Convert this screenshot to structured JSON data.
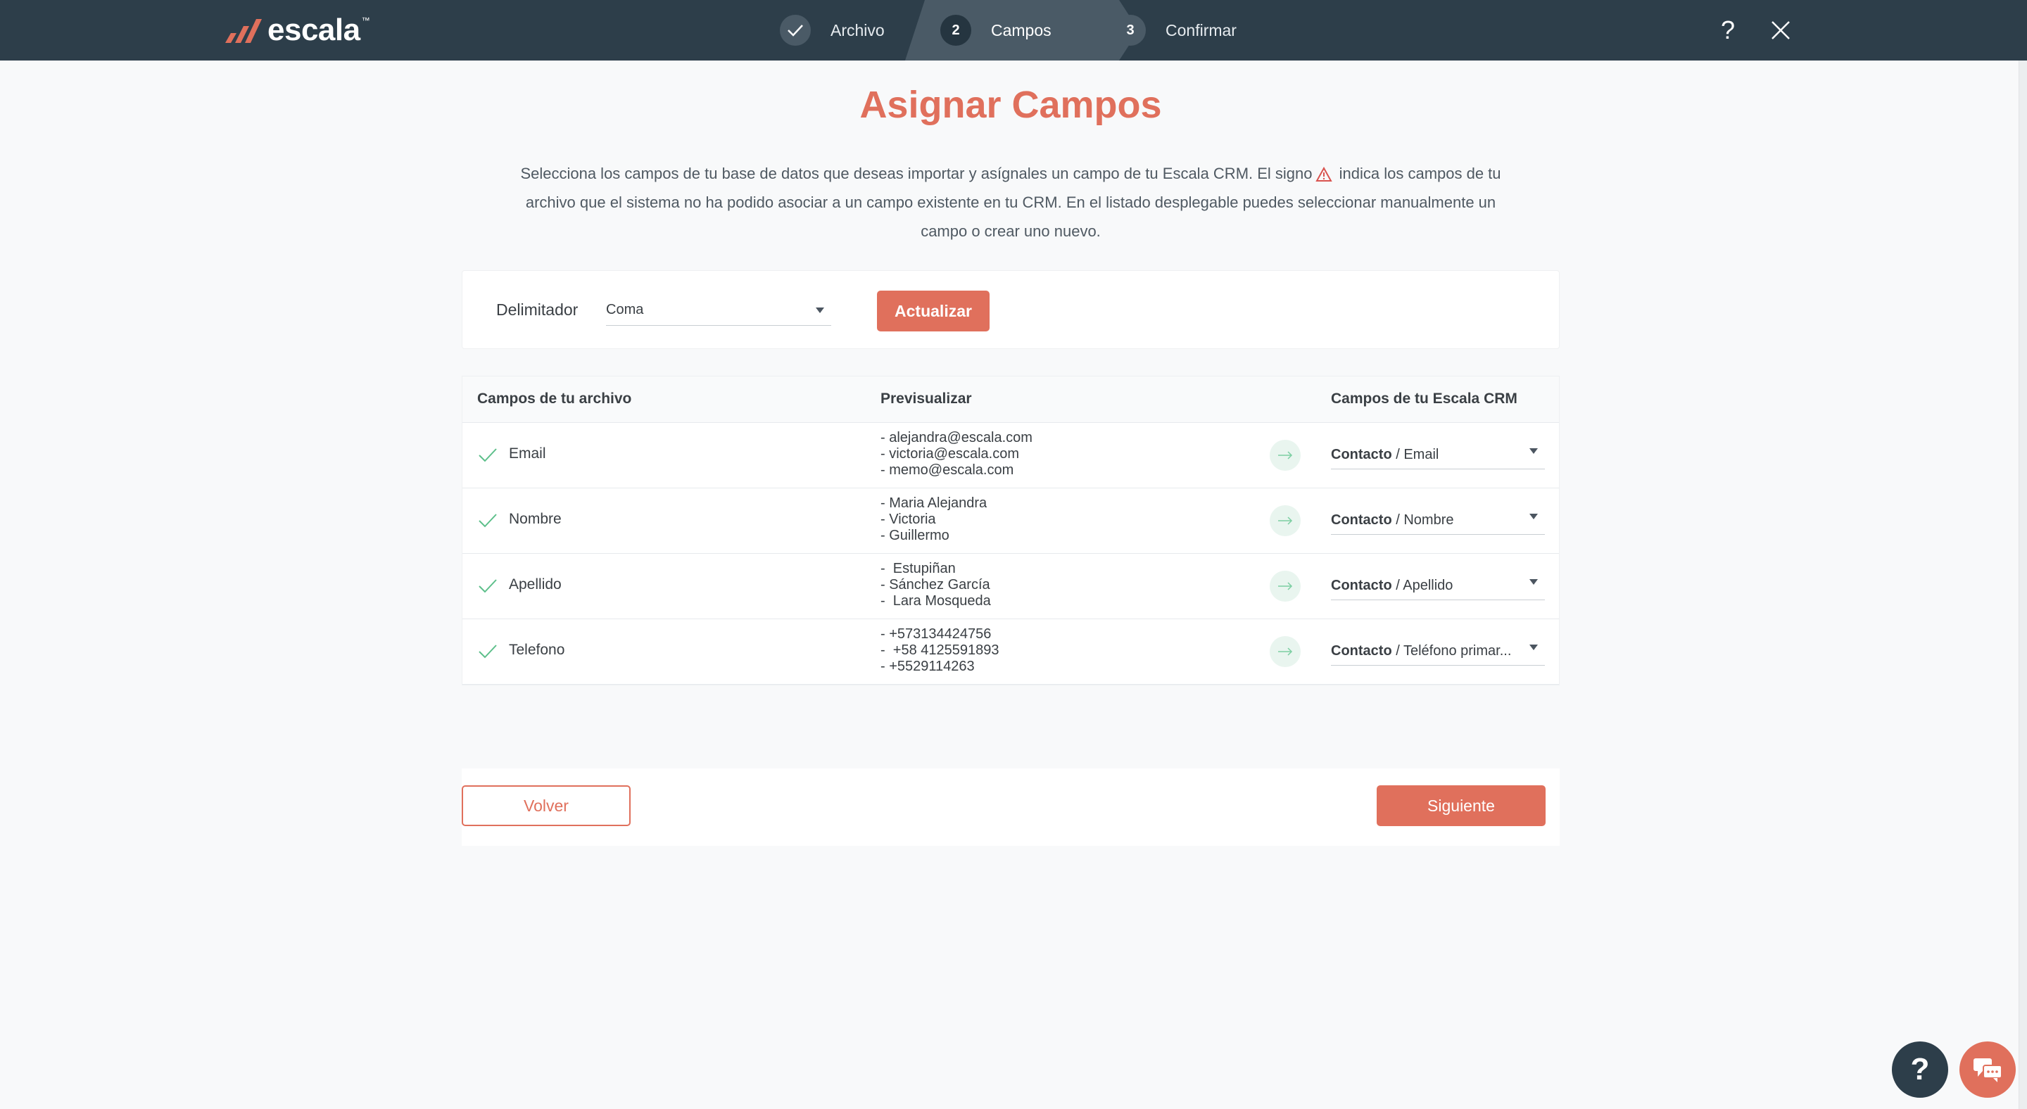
{
  "brand": {
    "name": "escala",
    "tm": "™",
    "accent": "#e0705c",
    "header_bg": "#2d3e4a"
  },
  "stepper": {
    "steps": [
      {
        "number": "",
        "icon": "check-icon",
        "label": "Archivo",
        "state": "done"
      },
      {
        "number": "2",
        "label": "Campos",
        "state": "active"
      },
      {
        "number": "3",
        "label": "Confirmar",
        "state": "pending"
      }
    ]
  },
  "header": {
    "help_glyph": "?",
    "close_icon": "close-icon"
  },
  "page": {
    "title": "Asignar Campos",
    "intro_part1": "Selecciona los campos de tu base de datos que deseas importar y asígnales un campo de tu Escala CRM. El signo",
    "intro_part2": " indica los campos de tu archivo que el sistema no ha podido asociar a un campo existente en tu CRM. En el listado desplegable puedes seleccionar manualmente un campo o crear uno nuevo."
  },
  "delimiter": {
    "label": "Delimitador",
    "value": "Coma",
    "update_button": "Actualizar"
  },
  "table": {
    "headers": {
      "file_fields": "Campos de tu archivo",
      "preview": "Previsualizar",
      "crm_fields": "Campos de tu Escala CRM"
    },
    "rows": [
      {
        "field": "Email",
        "preview": [
          "- alejandra@escala.com",
          "- victoria@escala.com",
          "- memo@escala.com"
        ],
        "map_entity": "Contacto",
        "map_field": " / Email"
      },
      {
        "field": "Nombre",
        "preview": [
          "- Maria Alejandra",
          "- Victoria",
          "- Guillermo"
        ],
        "map_entity": "Contacto",
        "map_field": " / Nombre"
      },
      {
        "field": "Apellido",
        "preview": [
          "-  Estupiñan",
          "- Sánchez García",
          "-  Lara Mosqueda"
        ],
        "map_entity": "Contacto",
        "map_field": " / Apellido"
      },
      {
        "field": "Telefono",
        "preview": [
          "- +573134424756",
          "-  +58 4125591893",
          "- +5529114263"
        ],
        "map_entity": "Contacto",
        "map_field": " / Teléfono primar..."
      }
    ]
  },
  "footer": {
    "back_button": "Volver",
    "next_button": "Siguiente"
  },
  "floating": {
    "help_glyph": "?",
    "chat_icon": "chat-icon"
  }
}
